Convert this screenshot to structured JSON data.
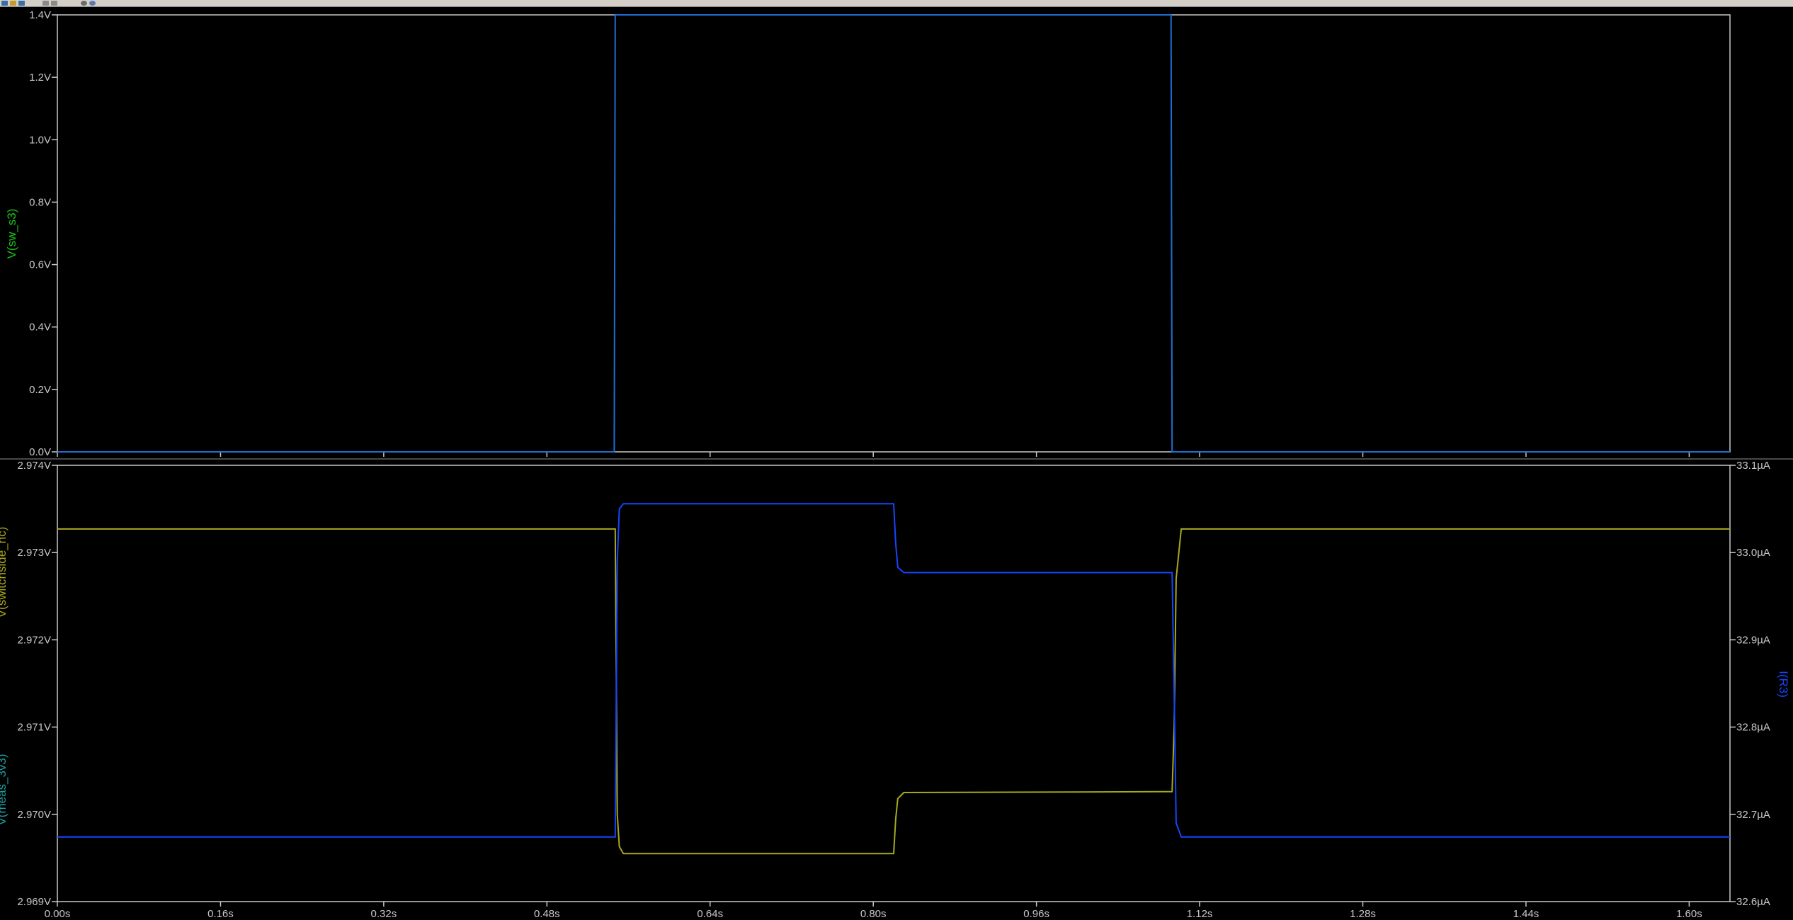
{
  "toolbar": {
    "icons": [
      "new-file-icon",
      "open-folder-icon",
      "save-icon",
      "undo-icon",
      "redo-icon",
      "zoom-icon",
      "settings-icon"
    ]
  },
  "colors": {
    "background": "#000000",
    "frame": "#c8c8c8",
    "sw_s3": "#1e6ed2",
    "switchside_nc": "#a8a81e",
    "meas_3v3": "#1e9ea0",
    "i_r3": "#1446ff",
    "label_sw_s3": "#19c819",
    "label_switchside_nc": "#a8a81e",
    "label_meas_3v3": "#1e9ea0",
    "label_i_r3": "#1446ff",
    "tick_text": "#c8c8c8"
  },
  "chart_data": [
    {
      "type": "line",
      "ylabel": "V(sw_s3)",
      "xlim": [
        0,
        1.64
      ],
      "ylim": [
        0,
        1.4
      ],
      "xticks": [
        "0.00s",
        "0.16s",
        "0.32s",
        "0.48s",
        "0.64s",
        "0.80s",
        "0.96s",
        "1.12s",
        "1.28s",
        "1.44s",
        "1.60s"
      ],
      "yticks": [
        "0.0V",
        "0.2V",
        "0.4V",
        "0.6V",
        "0.8V",
        "1.0V",
        "1.2V",
        "1.4V"
      ],
      "grid": false,
      "series": [
        {
          "name": "V(sw_s3)",
          "x": [
            0,
            0.546,
            0.547,
            1.092,
            1.093,
            1.64
          ],
          "y": [
            0,
            0,
            1.4,
            1.4,
            0,
            0
          ]
        }
      ]
    },
    {
      "type": "line",
      "ylabel": "V(switchside_nc)",
      "ylabel2": "V(meas_3v3)",
      "ylabel_right": "I(R3)",
      "xlim": [
        0,
        1.64
      ],
      "ylim": [
        2.969,
        2.974
      ],
      "ylim_right": [
        32.6,
        33.1
      ],
      "xticks": [
        "0.00s",
        "0.16s",
        "0.32s",
        "0.48s",
        "0.64s",
        "0.80s",
        "0.96s",
        "1.12s",
        "1.28s",
        "1.44s",
        "1.60s"
      ],
      "yticks": [
        "2.969V",
        "2.970V",
        "2.971V",
        "2.972V",
        "2.973V",
        "2.974V"
      ],
      "yticks_right": [
        "32.6µA",
        "32.7µA",
        "32.8µA",
        "32.9µA",
        "33.0µA",
        "33.1µA"
      ],
      "grid": false,
      "series": [
        {
          "name": "V(switchside_nc)",
          "axis": "left",
          "x": [
            0,
            0.547,
            0.549,
            0.551,
            0.555,
            0.82,
            0.822,
            0.824,
            0.83,
            1.093,
            1.095,
            1.097,
            1.102,
            1.64
          ],
          "y": [
            2.97327,
            2.97327,
            2.97,
            2.96963,
            2.96955,
            2.96955,
            2.96995,
            2.97018,
            2.97025,
            2.97026,
            2.971,
            2.9727,
            2.97327,
            2.97327
          ]
        },
        {
          "name": "I(R3)",
          "axis": "right",
          "x": [
            0,
            0.547,
            0.549,
            0.551,
            0.555,
            0.82,
            0.822,
            0.824,
            0.83,
            1.093,
            1.095,
            1.097,
            1.102,
            1.64
          ],
          "y": [
            32.674,
            32.674,
            32.99,
            33.05,
            33.056,
            33.056,
            33.01,
            32.983,
            32.977,
            32.977,
            32.84,
            32.69,
            32.674,
            32.674
          ]
        }
      ]
    }
  ]
}
